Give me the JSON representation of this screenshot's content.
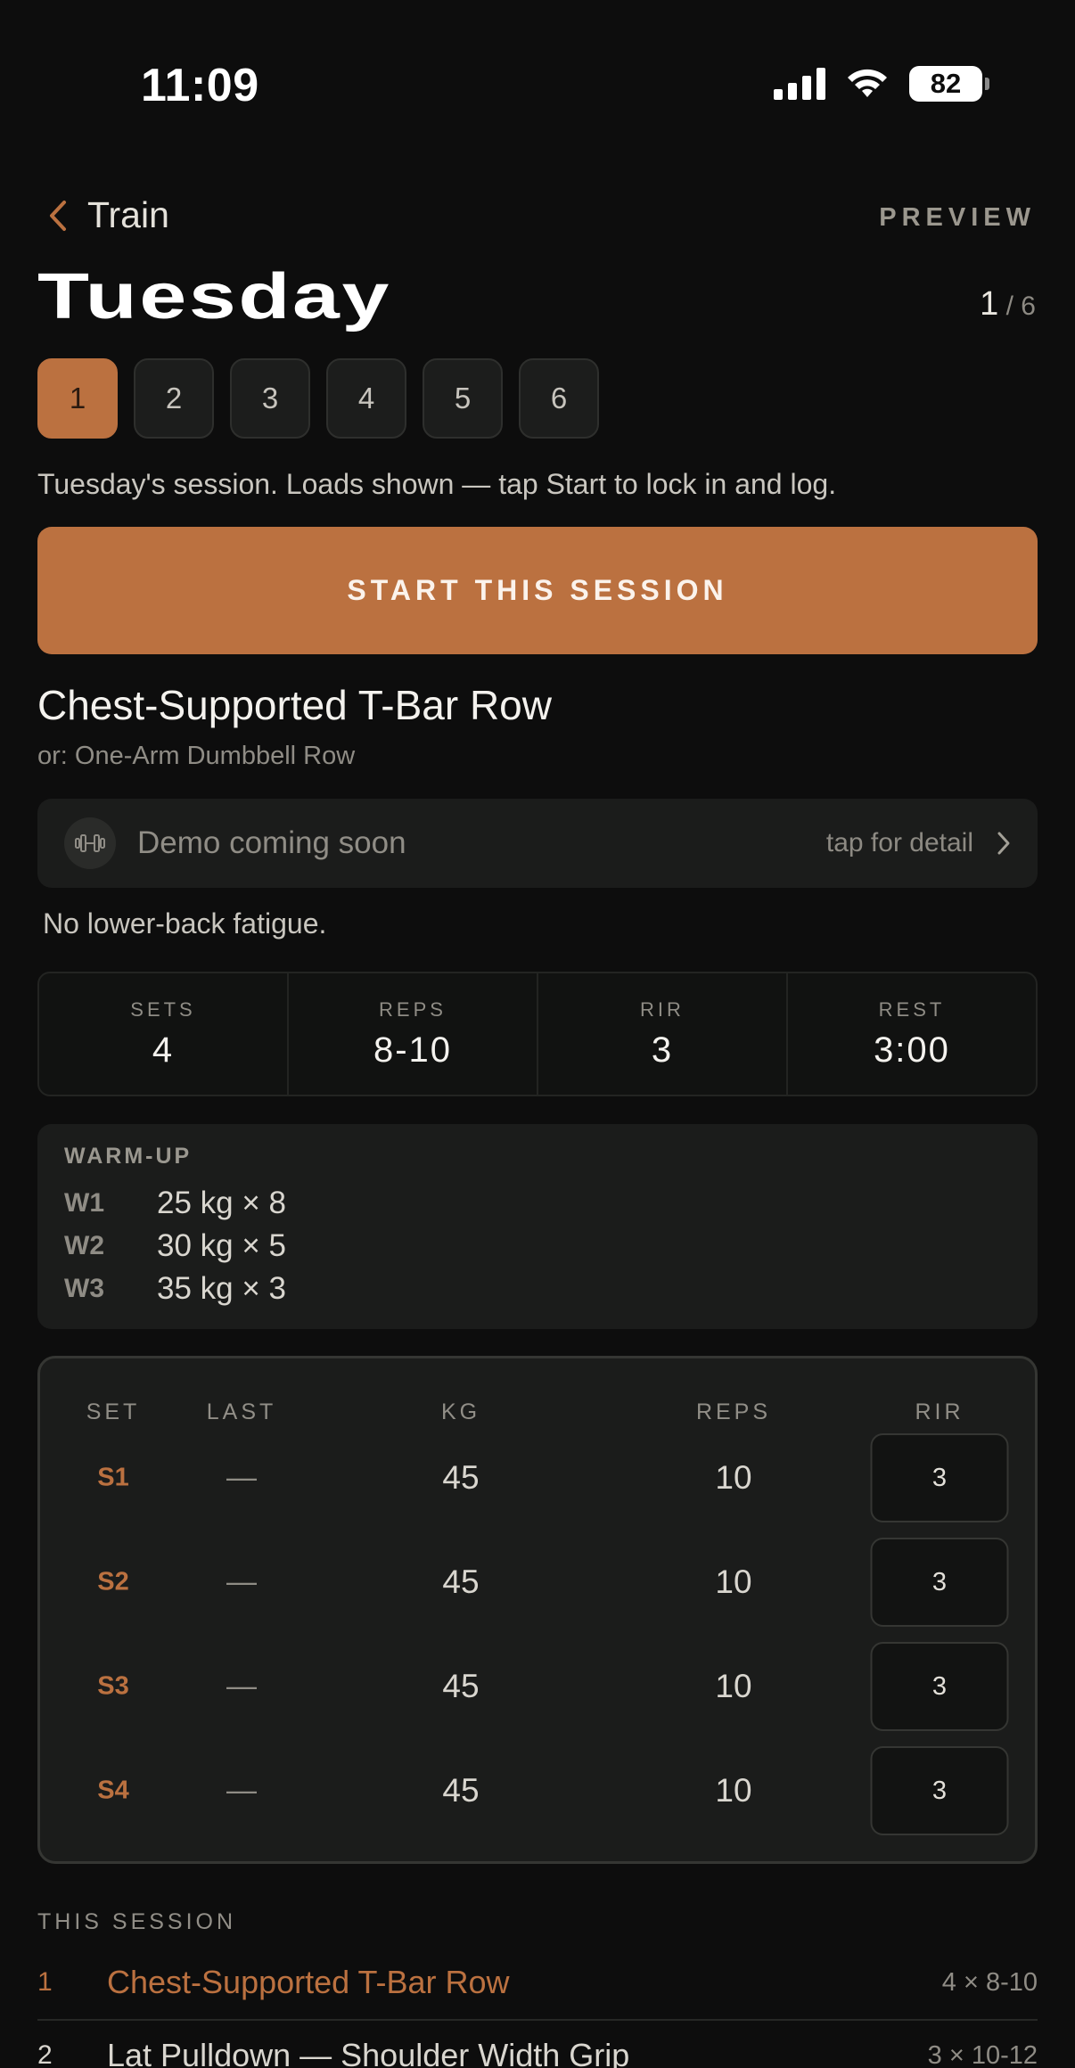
{
  "status_bar": {
    "time": "11:09",
    "battery": "82",
    "icons": [
      "signal-icon",
      "wifi-icon",
      "battery-icon"
    ]
  },
  "nav": {
    "back_label": "Train",
    "preview_label": "PREVIEW"
  },
  "day": {
    "title": "Tuesday",
    "current": "1",
    "total": "/ 6"
  },
  "day_pills": [
    "1",
    "2",
    "3",
    "4",
    "5",
    "6"
  ],
  "subtitle": "Tuesday's session. Loads shown — tap Start to lock in and log.",
  "start_button": "START THIS SESSION",
  "exercise": {
    "name": "Chest-Supported T-Bar Row",
    "alternative": "or: One-Arm Dumbbell Row",
    "demo_label": "Demo coming soon",
    "demo_tap": "tap for detail",
    "note": "No lower-back fatigue."
  },
  "stats": [
    {
      "label": "SETS",
      "value": "4"
    },
    {
      "label": "REPS",
      "value": "8-10"
    },
    {
      "label": "RIR",
      "value": "3"
    },
    {
      "label": "REST",
      "value": "3:00"
    }
  ],
  "warmup": {
    "title": "WARM-UP",
    "rows": [
      {
        "tag": "W1",
        "value": "25 kg × 8"
      },
      {
        "tag": "W2",
        "value": "30 kg × 5"
      },
      {
        "tag": "W3",
        "value": "35 kg × 3"
      }
    ]
  },
  "set_table": {
    "headers": {
      "set": "SET",
      "last": "LAST",
      "kg": "KG",
      "reps": "REPS",
      "rir": "RIR"
    },
    "rows": [
      {
        "set": "S1",
        "last": "—",
        "kg": "45",
        "reps": "10",
        "rir": "3"
      },
      {
        "set": "S2",
        "last": "—",
        "kg": "45",
        "reps": "10",
        "rir": "3"
      },
      {
        "set": "S3",
        "last": "—",
        "kg": "45",
        "reps": "10",
        "rir": "3"
      },
      {
        "set": "S4",
        "last": "—",
        "kg": "45",
        "reps": "10",
        "rir": "3"
      }
    ]
  },
  "this_session": {
    "title": "THIS SESSION",
    "items": [
      {
        "index": "1",
        "name": "Chest-Supported T-Bar Row",
        "sets": "4 × 8-10"
      },
      {
        "index": "2",
        "name": "Lat Pulldown — Shoulder Width Grip",
        "sets": "3 × 10-12"
      }
    ]
  },
  "colors": {
    "accent": "#bb7140",
    "background": "#0d0d0d",
    "card": "#1b1c1b"
  }
}
